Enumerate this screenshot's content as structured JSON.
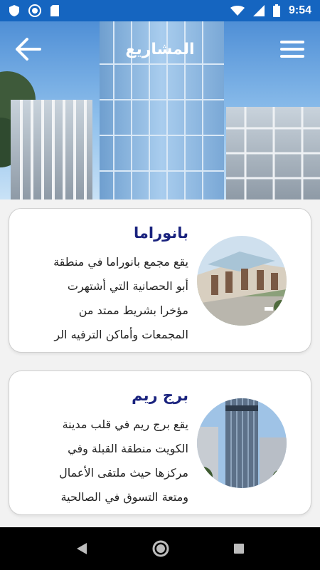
{
  "status_bar": {
    "time": "9:54",
    "left_icons": [
      "shield-icon",
      "circle-icon",
      "sd-card-icon"
    ],
    "right_icons": [
      "wifi-icon",
      "signal-icon",
      "battery-icon"
    ]
  },
  "header": {
    "title": "المشاريع",
    "back_icon": "arrow-left-icon",
    "menu_icon": "hamburger-menu-icon"
  },
  "projects": [
    {
      "title": "بانوراما",
      "description_lines": [
        "يقع مجمع بانوراما في منطقة",
        "أبو الحصانية التي  أشتهرت",
        "مؤخرا بشريط ممتد من",
        "المجمعات وأماكن الترفيه الر"
      ]
    },
    {
      "title": "برج ريم",
      "description_lines": [
        "يقع برج ريم في قلب مدينة",
        "الكويت منطقة القبلة  وفي",
        "مركزها حيث ملتقى الأعمال",
        "ومتعة التسوق في الصالحية"
      ]
    }
  ],
  "nav_bar": {
    "icons": [
      "back-triangle-icon",
      "home-circle-icon",
      "recents-square-icon"
    ]
  },
  "colors": {
    "status_bar": "#1565c0",
    "title_text": "#1a237e",
    "card_border": "#cfcfcf",
    "nav_bar": "#000000"
  }
}
